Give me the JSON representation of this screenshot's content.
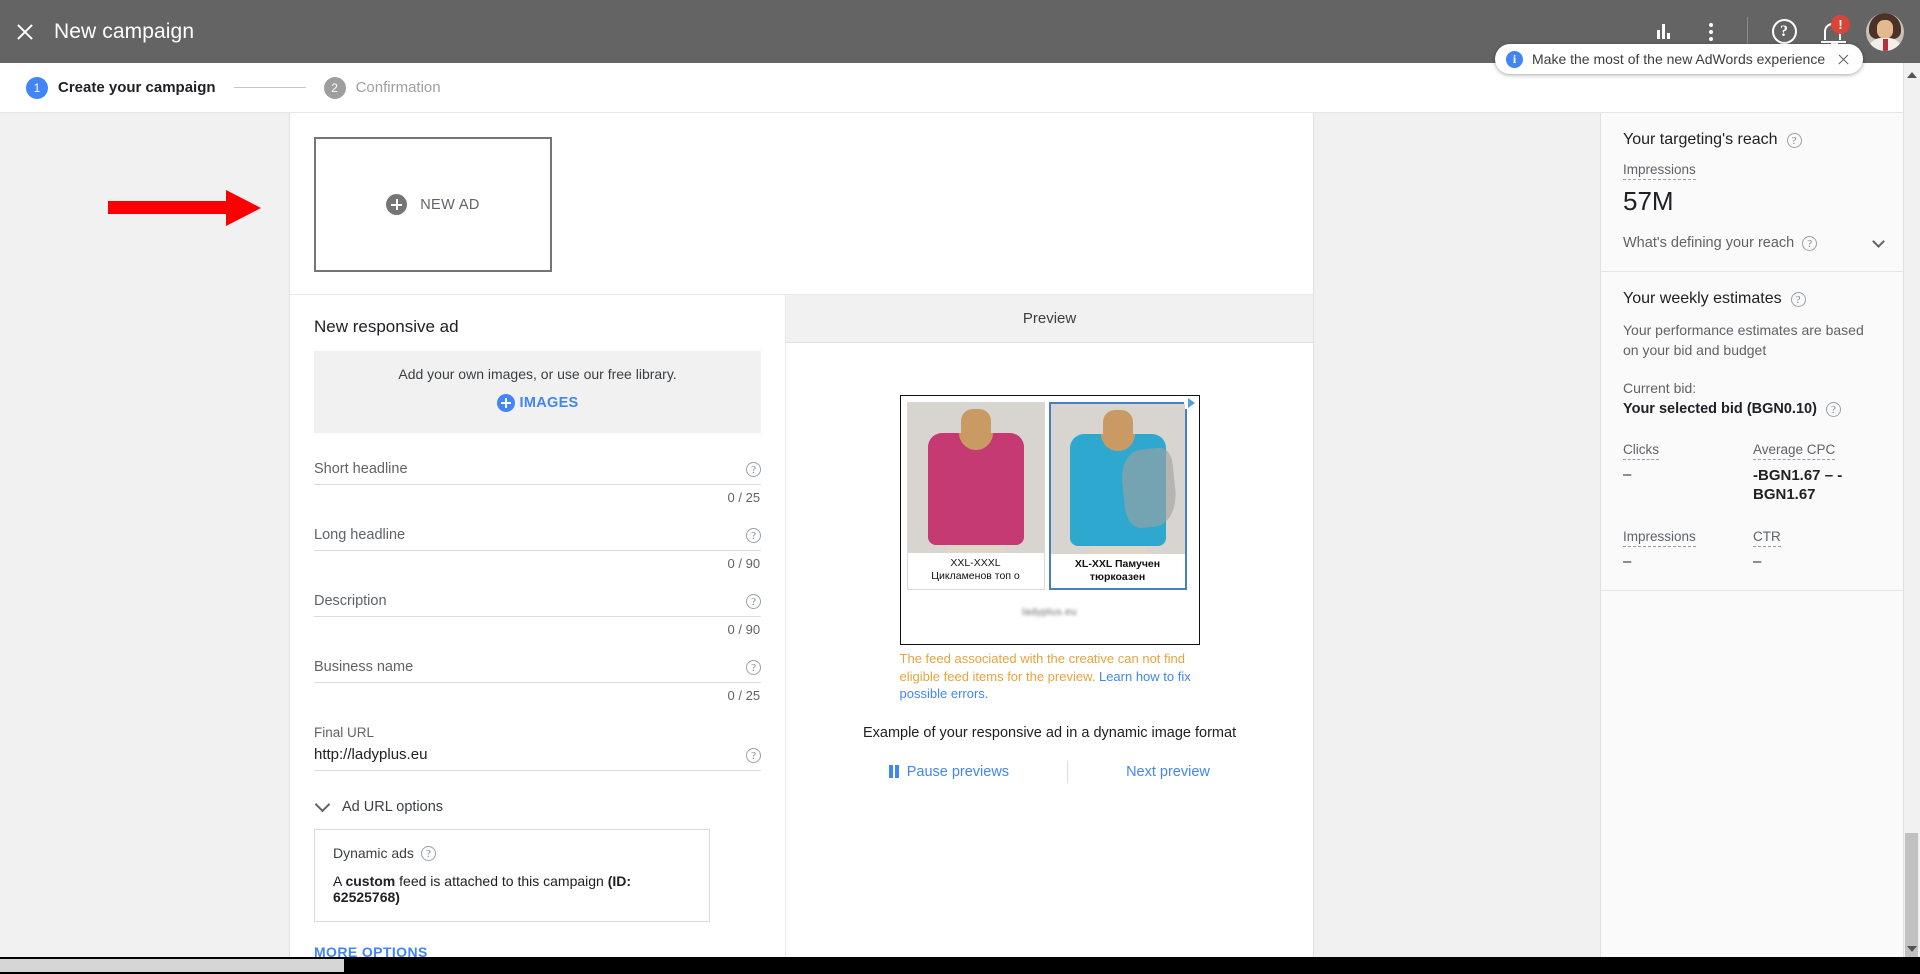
{
  "appbar": {
    "title": "New campaign",
    "close_icon": "close-icon",
    "icons": [
      "chart-bars-icon",
      "kebab-menu-icon",
      "help-circle-icon",
      "notifications-bell-icon"
    ],
    "notification_count": "!",
    "promo": {
      "text": "Make the most of the new AdWords experience",
      "info_icon": "info-icon",
      "close_icon": "close-icon"
    }
  },
  "stepper": {
    "steps": [
      {
        "num": "1",
        "label": "Create your campaign",
        "state": "active"
      },
      {
        "num": "2",
        "label": "Confirmation",
        "state": "inactive"
      }
    ]
  },
  "newad": {
    "label": "NEW AD",
    "plus_icon": "plus-circle-icon"
  },
  "form": {
    "title": "New responsive ad",
    "images_box": {
      "text": "Add your own images, or use our free library.",
      "button_label": "IMAGES",
      "plus_icon": "plus-circle-blue-icon"
    },
    "fields": [
      {
        "label": "Short headline",
        "value": "",
        "counter": "0 / 25",
        "help_icon": "help-icon"
      },
      {
        "label": "Long headline",
        "value": "",
        "counter": "0 / 90",
        "help_icon": "help-icon"
      },
      {
        "label": "Description",
        "value": "",
        "counter": "0 / 90",
        "help_icon": "help-icon"
      },
      {
        "label": "Business name",
        "value": "",
        "counter": "0 / 25",
        "help_icon": "help-icon"
      }
    ],
    "final_url": {
      "label": "Final URL",
      "value": "http://ladyplus.eu",
      "help_icon": "help-icon"
    },
    "ad_url_options": {
      "label": "Ad URL options",
      "chevron_icon": "chevron-down-icon"
    },
    "dynamic_ads": {
      "title": "Dynamic ads",
      "help_icon": "help-icon",
      "description_pre": "A ",
      "description_bold1": "custom",
      "description_mid": " feed is attached to this campaign ",
      "description_bold2": "(ID: 62525768)"
    },
    "more_options": "MORE OPTIONS"
  },
  "preview": {
    "header": "Preview",
    "adchoices_icon": "adchoices-icon",
    "tiles": [
      {
        "caption_line1": "XXL-XXXL",
        "caption_line2": "Цикламенов топ о",
        "selected": false,
        "shirt_color": "#c53a73"
      },
      {
        "caption_line1": "XL-XXL Памучен",
        "caption_line2": "тюркоазен",
        "selected": true,
        "shirt_color": "#2fa8cf"
      }
    ],
    "blurred_url": "ladyplus.eu",
    "warning_pre": "The feed associated with the creative can not find eligible feed items for the preview. ",
    "warning_link": "Learn how to fix possible errors.",
    "example_text": "Example of your responsive ad in a dynamic image format",
    "pause_label": "Pause previews",
    "pause_icon": "pause-icon",
    "next_label": "Next preview"
  },
  "rail": {
    "reach": {
      "title": "Your targeting's reach",
      "help_icon": "help-icon",
      "metric_label": "Impressions",
      "metric_value": "57M",
      "defining_label": "What's defining your reach",
      "defining_help_icon": "help-icon",
      "chevron_icon": "chevron-down-icon"
    },
    "estimates": {
      "title": "Your weekly estimates",
      "help_icon": "help-icon",
      "description": "Your performance estimates are based on your bid and budget",
      "current_bid_label": "Current bid:",
      "current_bid_value": "Your selected bid (BGN0.10)",
      "bid_help_icon": "help-icon",
      "metrics": [
        {
          "label": "Clicks",
          "value": "–",
          "bold": false
        },
        {
          "label": "Average CPC",
          "value": "-BGN1.67 – -BGN1.67",
          "bold": true
        },
        {
          "label": "Impressions",
          "value": "–",
          "bold": false
        },
        {
          "label": "CTR",
          "value": "–",
          "bold": false
        }
      ]
    }
  },
  "annotation": {
    "arrow_color": "#fb0000",
    "arrow_name": "red-pointer-arrow"
  }
}
